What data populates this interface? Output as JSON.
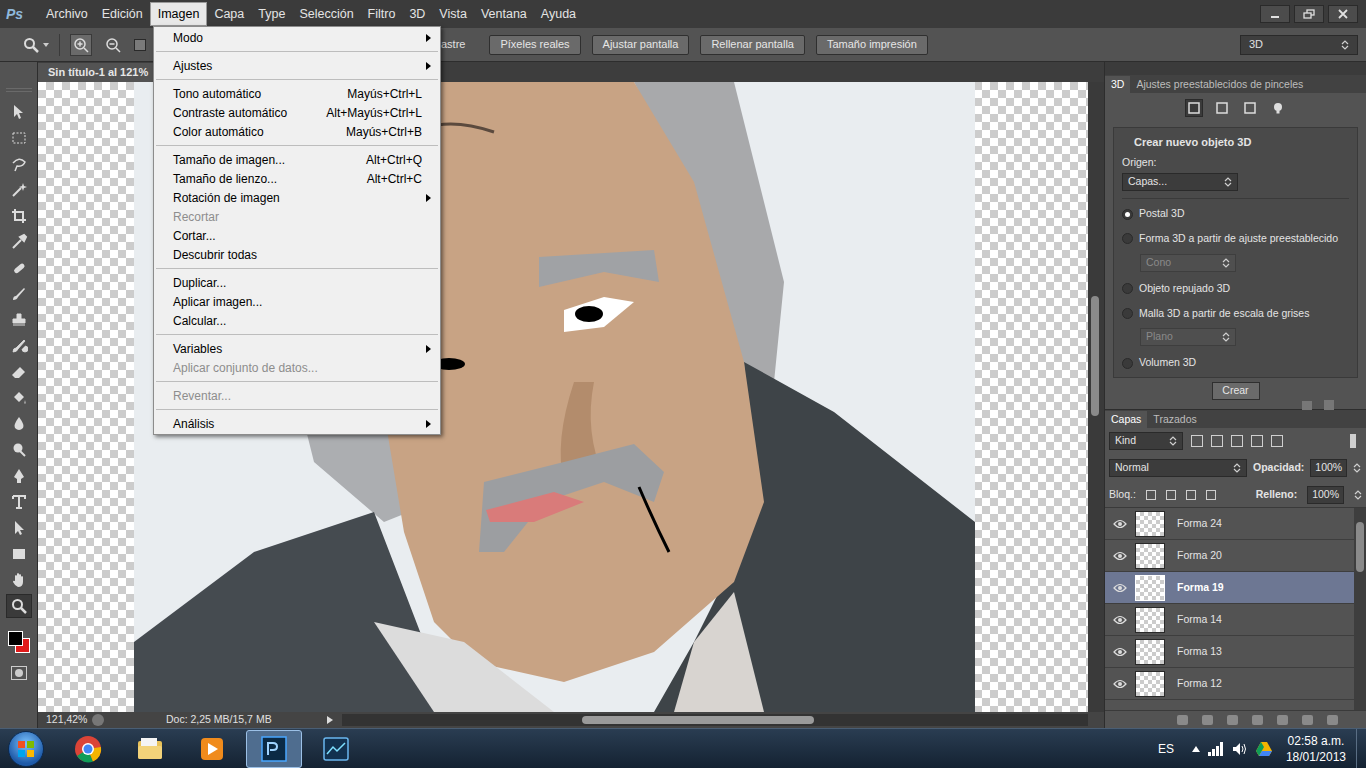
{
  "app": {
    "logo": "Ps"
  },
  "menu_bar": {
    "items": [
      {
        "label": "Archivo",
        "selected": false
      },
      {
        "label": "Edición",
        "selected": false
      },
      {
        "label": "Imagen",
        "selected": true
      },
      {
        "label": "Capa",
        "selected": false
      },
      {
        "label": "Type",
        "selected": false
      },
      {
        "label": "Selección",
        "selected": false
      },
      {
        "label": "Filtro",
        "selected": false
      },
      {
        "label": "3D",
        "selected": false
      },
      {
        "label": "Vista",
        "selected": false
      },
      {
        "label": "Ventana",
        "selected": false
      },
      {
        "label": "Ayuda",
        "selected": false
      }
    ]
  },
  "options_bar": {
    "partial_label": "astre",
    "buttons": [
      "Píxeles reales",
      "Ajustar pantalla",
      "Rellenar pantalla",
      "Tamaño impresión"
    ],
    "workspace": "3D"
  },
  "document": {
    "tab": "Sin título-1 al 121%"
  },
  "image_menu": {
    "items": [
      {
        "kind": "item",
        "label": "Modo",
        "shortcut": "",
        "submenu": true,
        "disabled": false
      },
      {
        "kind": "separator"
      },
      {
        "kind": "item",
        "label": "Ajustes",
        "shortcut": "",
        "submenu": true,
        "disabled": false
      },
      {
        "kind": "separator"
      },
      {
        "kind": "item",
        "label": "Tono automático",
        "shortcut": "Mayús+Ctrl+L",
        "submenu": false,
        "disabled": false
      },
      {
        "kind": "item",
        "label": "Contraste automático",
        "shortcut": "Alt+Mayús+Ctrl+L",
        "submenu": false,
        "disabled": false
      },
      {
        "kind": "item",
        "label": "Color automático",
        "shortcut": "Mayús+Ctrl+B",
        "submenu": false,
        "disabled": false
      },
      {
        "kind": "separator"
      },
      {
        "kind": "item",
        "label": "Tamaño de imagen...",
        "shortcut": "Alt+Ctrl+Q",
        "submenu": false,
        "disabled": false
      },
      {
        "kind": "item",
        "label": "Tamaño de lienzo...",
        "shortcut": "Alt+Ctrl+C",
        "submenu": false,
        "disabled": false
      },
      {
        "kind": "item",
        "label": "Rotación de imagen",
        "shortcut": "",
        "submenu": true,
        "disabled": false
      },
      {
        "kind": "item",
        "label": "Recortar",
        "shortcut": "",
        "submenu": false,
        "disabled": true
      },
      {
        "kind": "item",
        "label": "Cortar...",
        "shortcut": "",
        "submenu": false,
        "disabled": false
      },
      {
        "kind": "item",
        "label": "Descubrir todas",
        "shortcut": "",
        "submenu": false,
        "disabled": false
      },
      {
        "kind": "separator"
      },
      {
        "kind": "item",
        "label": "Duplicar...",
        "shortcut": "",
        "submenu": false,
        "disabled": false
      },
      {
        "kind": "item",
        "label": "Aplicar imagen...",
        "shortcut": "",
        "submenu": false,
        "disabled": false
      },
      {
        "kind": "item",
        "label": "Calcular...",
        "shortcut": "",
        "submenu": false,
        "disabled": false
      },
      {
        "kind": "separator"
      },
      {
        "kind": "item",
        "label": "Variables",
        "shortcut": "",
        "submenu": true,
        "disabled": false
      },
      {
        "kind": "item",
        "label": "Aplicar conjunto de datos...",
        "shortcut": "",
        "submenu": false,
        "disabled": true
      },
      {
        "kind": "separator"
      },
      {
        "kind": "item",
        "label": "Reventar...",
        "shortcut": "",
        "submenu": false,
        "disabled": true
      },
      {
        "kind": "separator"
      },
      {
        "kind": "item",
        "label": "Análisis",
        "shortcut": "",
        "submenu": true,
        "disabled": false
      }
    ]
  },
  "tools": [
    {
      "kind": "move",
      "selected": false
    },
    {
      "kind": "marquee",
      "selected": false
    },
    {
      "kind": "lasso",
      "selected": false
    },
    {
      "kind": "wand",
      "selected": false
    },
    {
      "kind": "crop",
      "selected": false
    },
    {
      "kind": "eyedropper",
      "selected": false
    },
    {
      "kind": "heal",
      "selected": false
    },
    {
      "kind": "brush",
      "selected": false
    },
    {
      "kind": "stamp",
      "selected": false
    },
    {
      "kind": "history",
      "selected": false
    },
    {
      "kind": "eraser",
      "selected": false
    },
    {
      "kind": "bucket",
      "selected": false
    },
    {
      "kind": "blur",
      "selected": false
    },
    {
      "kind": "dodge",
      "selected": false
    },
    {
      "kind": "pen",
      "selected": false
    },
    {
      "kind": "type",
      "selected": false
    },
    {
      "kind": "path",
      "selected": false
    },
    {
      "kind": "shape",
      "selected": false
    },
    {
      "kind": "hand",
      "selected": false
    },
    {
      "kind": "zoom",
      "selected": true
    }
  ],
  "colors": {
    "foreground": "#000000",
    "background": "#e01b1b"
  },
  "panel_3d": {
    "tabs": [
      {
        "label": "3D",
        "selected": true
      },
      {
        "label": "Ajustes preestablecidos de pinceles",
        "selected": false
      }
    ],
    "section_title": "Crear nuevo objeto 3D",
    "source_label": "Origen:",
    "source_value": "Capas...",
    "options": [
      {
        "label": "Postal 3D",
        "selected": true,
        "dropdown": ""
      },
      {
        "label": "Forma 3D a partir de ajuste preestablecido",
        "selected": false,
        "dropdown": "Cono"
      },
      {
        "label": "Objeto repujado 3D",
        "selected": false,
        "dropdown": ""
      },
      {
        "label": "Malla 3D a partir de escala de grises",
        "selected": false,
        "dropdown": "Plano"
      },
      {
        "label": "Volumen 3D",
        "selected": false,
        "dropdown": ""
      }
    ],
    "button": "Crear"
  },
  "layers_panel": {
    "tabs": [
      {
        "label": "Capas",
        "selected": true
      },
      {
        "label": "Trazados",
        "selected": false
      }
    ],
    "filter": "Kind",
    "blend_mode": "Normal",
    "opacity_label": "Opacidad:",
    "opacity": "100%",
    "lock_label": "Bloq.:",
    "fill_label": "Relleno:",
    "fill": "100%",
    "layers": [
      {
        "name": "Forma 24",
        "visible": true,
        "selected": false
      },
      {
        "name": "Forma 20",
        "visible": true,
        "selected": false
      },
      {
        "name": "Forma 19",
        "visible": true,
        "selected": true
      },
      {
        "name": "Forma 14",
        "visible": true,
        "selected": false
      },
      {
        "name": "Forma 13",
        "visible": true,
        "selected": false
      },
      {
        "name": "Forma 12",
        "visible": true,
        "selected": false
      }
    ]
  },
  "status_bar": {
    "zoom": "121,42%",
    "doc": "Doc: 2,25 MB/15,7 MB"
  },
  "taskbar": {
    "apps": [
      {
        "kind": "chrome",
        "active": false
      },
      {
        "kind": "explorer",
        "active": false
      },
      {
        "kind": "media",
        "active": false
      },
      {
        "kind": "photoshop",
        "active": true
      },
      {
        "kind": "other",
        "active": false
      }
    ],
    "language": "ES",
    "time": "02:58 a.m.",
    "date": "18/01/2013"
  }
}
